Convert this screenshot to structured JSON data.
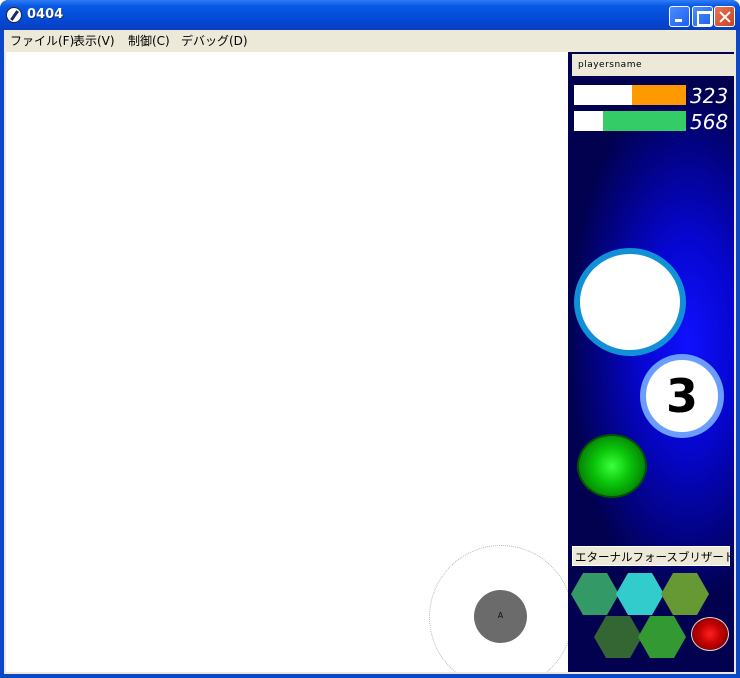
{
  "window": {
    "title": "0404"
  },
  "menu": [
    {
      "label": "ファイル(F)"
    },
    {
      "label": "表示(V)"
    },
    {
      "label": "制御(C)"
    },
    {
      "label": "デバッグ(D)"
    }
  ],
  "joystick": {
    "label": "A"
  },
  "hud": {
    "player_name": "playersname",
    "bars": [
      {
        "value": "323",
        "fill_fraction": 0.48,
        "color": "#ff9900"
      },
      {
        "value": "568",
        "fill_fraction": 0.74,
        "color": "#33cc66"
      }
    ],
    "counter": "3",
    "skill_name": "エターナルフォースブリザード",
    "skill_hexes": [
      {
        "color": "#339966"
      },
      {
        "color": "#33cccc"
      },
      {
        "color": "#669933"
      },
      {
        "color": "#336633"
      },
      {
        "color": "#339933"
      }
    ]
  },
  "colors": {
    "title_bar": "#0a47c9",
    "menu_bg": "#ece9d8",
    "panel_bg": "#0606d0",
    "ring_blue": "#1190d8"
  }
}
